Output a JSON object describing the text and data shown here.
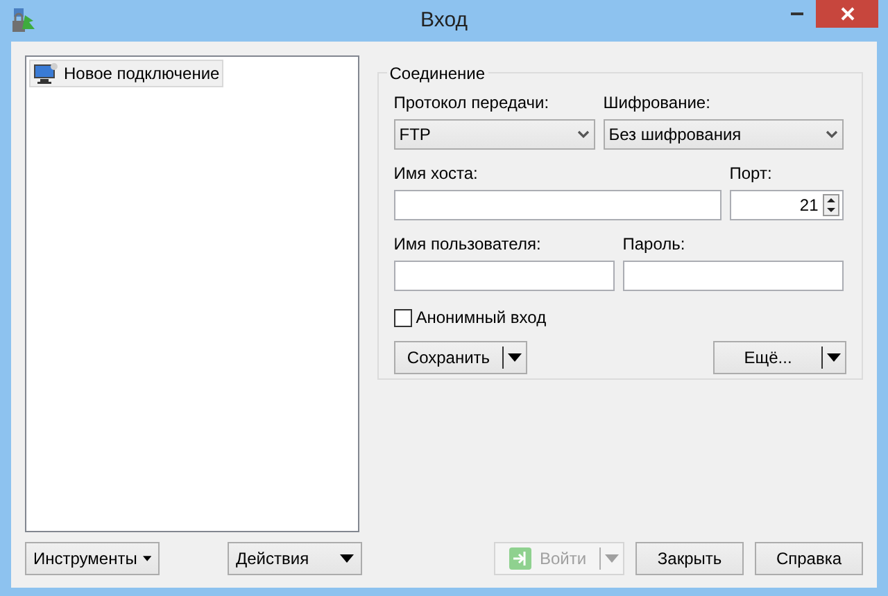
{
  "window": {
    "title": "Вход"
  },
  "sites": [
    {
      "label": "Новое подключение",
      "selected": true
    }
  ],
  "session": {
    "group_title": "Соединение",
    "protocol": {
      "label": "Протокол передачи:",
      "value": "FTP"
    },
    "encryption": {
      "label": "Шифрование:",
      "value": "Без шифрования"
    },
    "host": {
      "label": "Имя хоста:"
    },
    "port": {
      "label": "Порт:",
      "value": "21"
    },
    "user": {
      "label": "Имя пользователя:"
    },
    "password": {
      "label": "Пароль:"
    },
    "anonymous": {
      "label": "Анонимный вход",
      "checked": false
    },
    "save_button": {
      "label": "Сохранить"
    },
    "more_button": {
      "label": "Ещё..."
    }
  },
  "left_buttons": [
    {
      "label": "Инструменты"
    },
    {
      "label": "Действия"
    }
  ],
  "bottom_buttons": [
    {
      "label": "Войти",
      "kind": "split",
      "disabled": true
    },
    {
      "label": "Закрыть",
      "kind": "plain",
      "disabled": false
    },
    {
      "label": "Справка",
      "kind": "plain",
      "disabled": false
    }
  ]
}
